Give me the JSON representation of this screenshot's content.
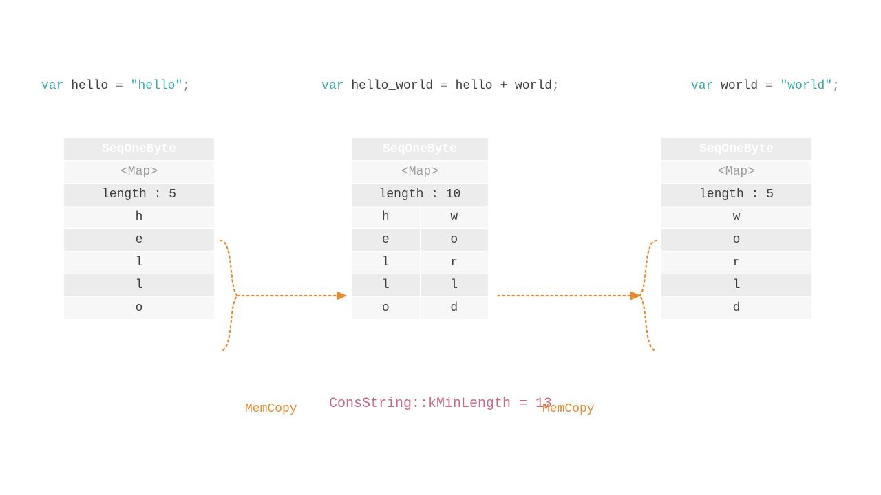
{
  "code": {
    "left": {
      "var": "var",
      "name": "hello",
      "eq": " = ",
      "lit": "\"hello\"",
      "semi": ";"
    },
    "mid": {
      "var": "var",
      "name": "hello_world",
      "eq": " = ",
      "expr": "hello + world",
      "semi": ";"
    },
    "right": {
      "var": "var",
      "name": "world",
      "eq": " = ",
      "lit": "\"world\"",
      "semi": ";"
    }
  },
  "tables": {
    "left": {
      "header": "SeqOneByte",
      "map": "<Map>",
      "length": "length : 5",
      "cells": [
        "h",
        "e",
        "l",
        "l",
        "o"
      ]
    },
    "mid": {
      "header": "SeqOneByte",
      "map": "<Map>",
      "length": "length : 10",
      "left": [
        "h",
        "e",
        "l",
        "l",
        "o"
      ],
      "right": [
        "w",
        "o",
        "r",
        "l",
        "d"
      ]
    },
    "right": {
      "header": "SeqOneByte",
      "map": "<Map>",
      "length": "length : 5",
      "cells": [
        "w",
        "o",
        "r",
        "l",
        "d"
      ]
    }
  },
  "labels": {
    "memcopy": "MemCopy"
  },
  "footer": "ConsString::kMinLength = 13",
  "colors": {
    "keyword": "#3aa8a8",
    "string": "#3aa8a8",
    "text": "#3f3f3f",
    "muted": "#878787",
    "orange": "#e88a2f",
    "pink": "#c96884",
    "tableHeader": "#8a8a8a"
  }
}
